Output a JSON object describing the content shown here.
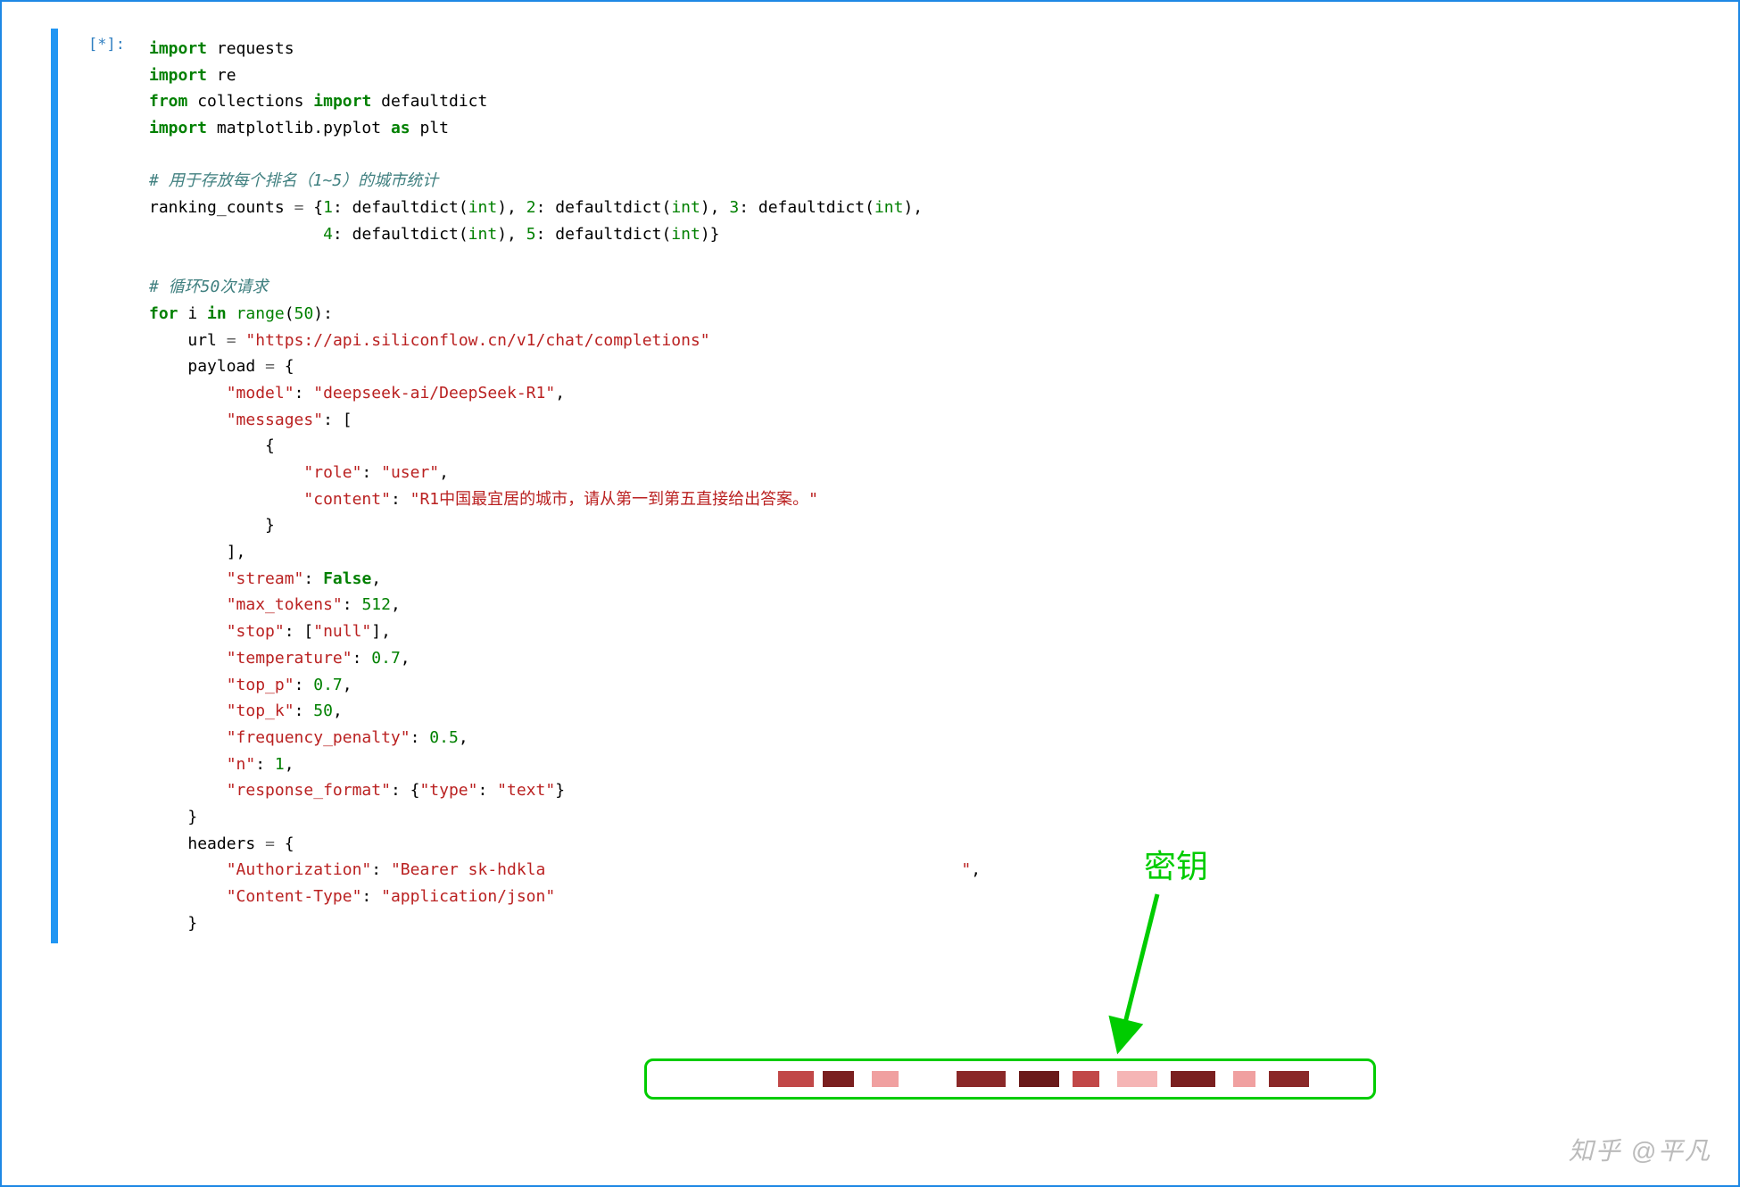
{
  "prompt": "[*]:",
  "code": {
    "line1": {
      "kw1": "import",
      "nm1": "requests"
    },
    "line2": {
      "kw1": "import",
      "nm1": "re"
    },
    "line3": {
      "kw1": "from",
      "nm1": "collections",
      "kw2": "import",
      "nm2": "defaultdict"
    },
    "line4": {
      "kw1": "import",
      "nm1": "matplotlib.pyplot",
      "kw2": "as",
      "nm2": "plt"
    },
    "comment1": "# 用于存放每个排名（1~5）的城市统计",
    "line6a": "ranking_counts ",
    "line6b": " {",
    "line6num1": "1",
    "line6def": "defaultdict",
    "line6int": "int",
    "line6num2": "2",
    "line6num3": "3",
    "line7num4": "4",
    "line7num5": "5",
    "comment2": "# 循环50次请求",
    "forline": {
      "kw1": "for",
      "nm1": "i",
      "kw2": "in",
      "fn": "range",
      "num": "50"
    },
    "urlline": {
      "nm": "url",
      "str": "\"https://api.siliconflow.cn/v1/chat/completions\""
    },
    "payloadline": "payload ",
    "model_key": "\"model\"",
    "model_val": "\"deepseek-ai/DeepSeek-R1\"",
    "messages_key": "\"messages\"",
    "role_key": "\"role\"",
    "role_val": "\"user\"",
    "content_key": "\"content\"",
    "content_val": "\"R1中国最宜居的城市，请从第一到第五直接给出答案。\"",
    "stream_key": "\"stream\"",
    "stream_val": "False",
    "maxtok_key": "\"max_tokens\"",
    "maxtok_val": "512",
    "stop_key": "\"stop\"",
    "stop_val": "\"null\"",
    "temp_key": "\"temperature\"",
    "temp_val": "0.7",
    "topp_key": "\"top_p\"",
    "topp_val": "0.7",
    "topk_key": "\"top_k\"",
    "topk_val": "50",
    "freq_key": "\"frequency_penalty\"",
    "freq_val": "0.5",
    "n_key": "\"n\"",
    "n_val": "1",
    "resp_key": "\"response_format\"",
    "type_key": "\"type\"",
    "type_val": "\"text\"",
    "headers_nm": "headers ",
    "auth_key": "\"Authorization\"",
    "auth_val": "\"Bearer sk-hdkla",
    "ctype_key": "\"Content-Type\"",
    "ctype_val": "\"application/json\""
  },
  "annotation_label": "密钥",
  "watermark": "知乎 @平凡"
}
